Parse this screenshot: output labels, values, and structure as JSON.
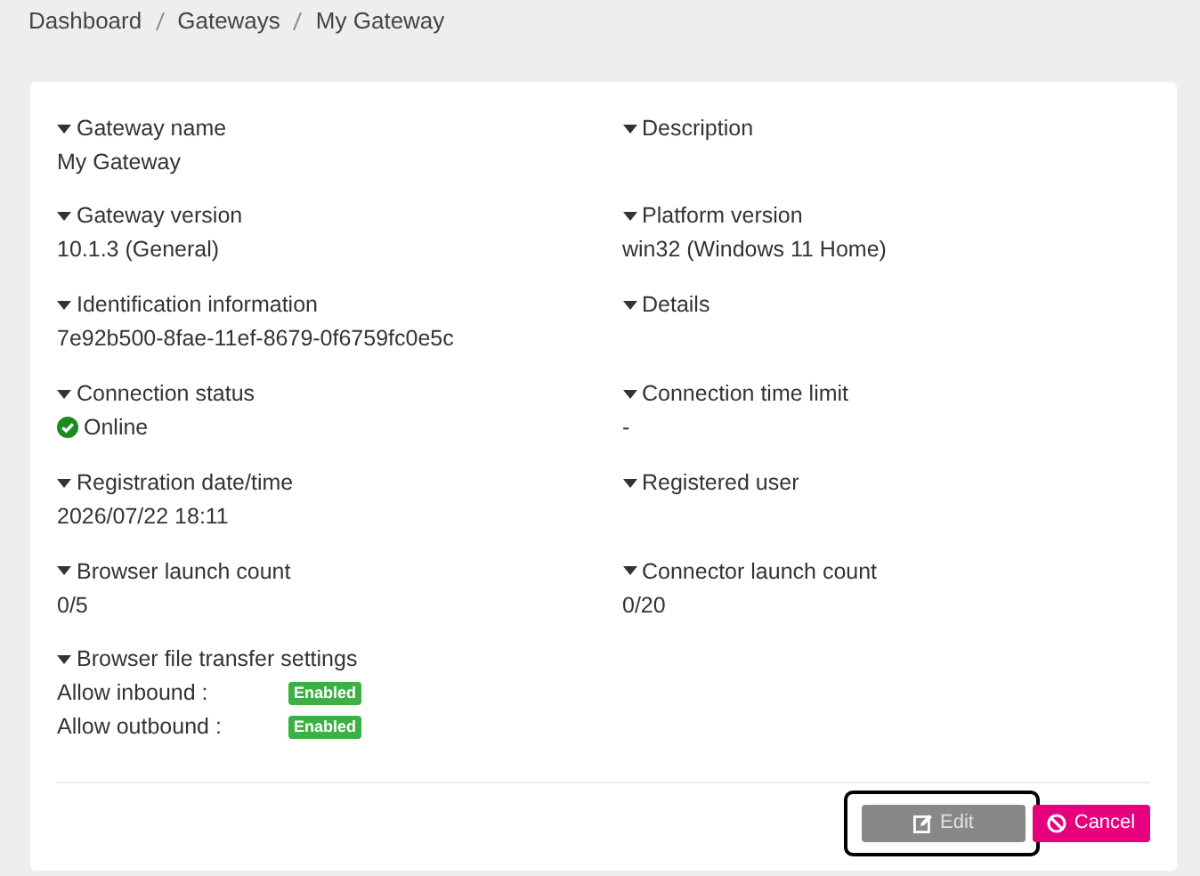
{
  "breadcrumb": [
    "Dashboard",
    "Gateways",
    "My Gateway"
  ],
  "fields": [
    {
      "label": "Gateway name",
      "value": "My Gateway"
    },
    {
      "label": "Description"
    },
    {
      "label": "Gateway version",
      "value": "10.1.3 (General)"
    },
    {
      "label": "Platform version",
      "value": "win32 (Windows 11 Home)"
    },
    {
      "label": "Identification information",
      "value": "7e92b500-8fae-11ef-8679-0f6759fc0e5c"
    },
    {
      "label": "Details"
    },
    {
      "label": "Connection status",
      "value": "Online",
      "kind": "status"
    },
    {
      "label": "Connection time limit",
      "value": "-"
    },
    {
      "label": "Registration date/time",
      "value": "2026/07/22 18:11"
    },
    {
      "label": "Registered user"
    },
    {
      "label": "Browser launch count",
      "value": "0/5"
    },
    {
      "label": "Connector launch count",
      "value": "0/20"
    }
  ],
  "transfer": {
    "label": "Browser file transfer settings",
    "settings": [
      {
        "label": "Allow inbound :",
        "badge": "Enabled"
      },
      {
        "label": "Allow outbound :",
        "badge": "Enabled"
      }
    ]
  },
  "buttons": [
    {
      "label": "Edit",
      "kind": "edit",
      "disabled": true,
      "highlighted": true
    },
    {
      "label": "Cancel",
      "kind": "cancel",
      "disabled": false,
      "highlighted": false
    }
  ]
}
